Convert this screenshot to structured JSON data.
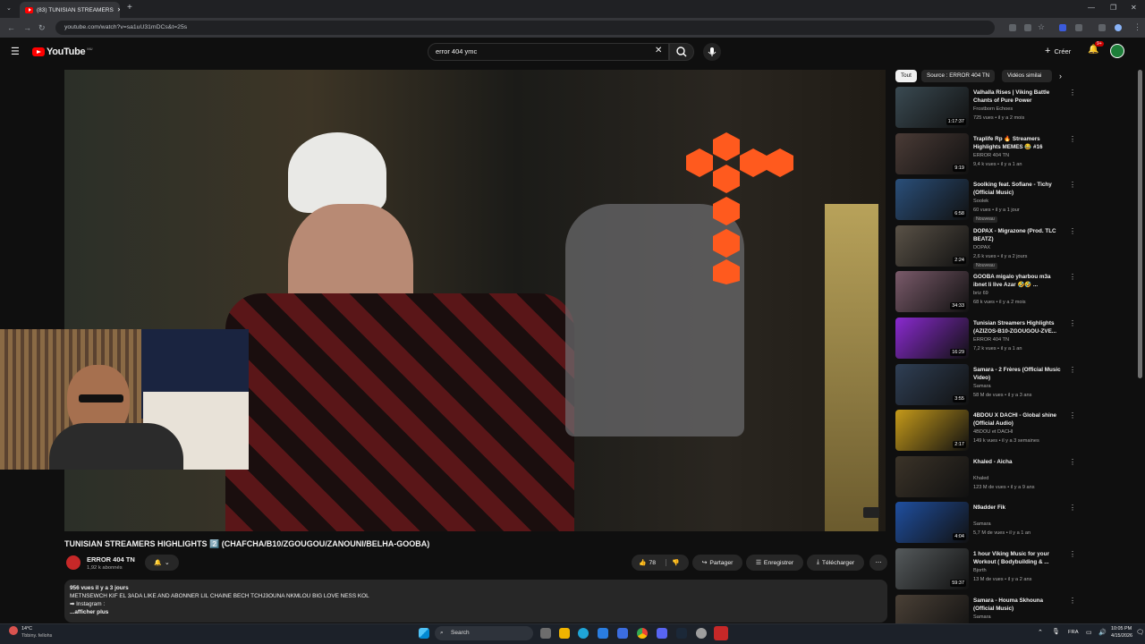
{
  "browser": {
    "tab_title": "(83) TUNISIAN STREAMERS",
    "url": "youtube.com/watch?v=sa1uU31mDCs&t=25s"
  },
  "youtube": {
    "logo": "YouTube",
    "region": "MU",
    "search_value": "error 404 ymc",
    "create_label": "Créer",
    "notif_count": "9+"
  },
  "video": {
    "title": "TUNISIAN STREAMERS HIGHLIGHTS 2️⃣ (CHAFCHA/B10/ZGOUGOU/ZANOUNI/BELHA-GOOBA)",
    "channel": "ERROR 404 TN",
    "subscribers": "1,92 k abonnés",
    "likes": "78",
    "share": "Partager",
    "save": "Enregistrer",
    "download": "Télécharger",
    "desc_meta": "956 vues  il y a 3 jours",
    "desc_line1": "METNSEWCH KIF EL 3ADA LIKE AND ABONNER LIL CHAINE BECH TCHJ3OUNA NKMLOU BIG LOVE NESS KOL",
    "desc_line2": "➡ Instagram :",
    "desc_more": "...afficher plus"
  },
  "chips": [
    "Tout",
    "Source : ERROR 404 TN",
    "Vidéos similai"
  ],
  "recommendations": [
    {
      "title": "Valhalla Rises | Viking Battle Chants of Pure Power",
      "channel": "Frostborn Echoes",
      "meta": "725 vues • il y a 2 mois",
      "duration": "1:17:37",
      "badge": "",
      "color": "#3a4a52"
    },
    {
      "title": "Traplife Rp 🔥 Streamers Highlights MEMES 😂 #16",
      "channel": "ERROR 404 TN",
      "meta": "9,4 k vues • il y a 1 an",
      "duration": "9:19",
      "badge": "",
      "color": "#4a3b36"
    },
    {
      "title": "Soolking feat. Sofiane - Tichy (Official Music)",
      "channel": "Soolek",
      "meta": "60 vues • il y a 1 jour",
      "duration": "6:58",
      "badge": "Nouveau",
      "color": "#2a4f7a"
    },
    {
      "title": "DOPAX - Migrazone (Prod. TLC BEATZ)",
      "channel": "DOPAX",
      "meta": "2,6 k vues • il y a 2 jours",
      "duration": "2:24",
      "badge": "Nouveau",
      "color": "#5a5247"
    },
    {
      "title": "GOOBA migalo yharbou m3a ibnet li live Azar 🤣🤣 ...",
      "channel": "briz 69",
      "meta": "68 k vues • il y a 2 mois",
      "duration": "34:33",
      "badge": "",
      "color": "#7a5a6a"
    },
    {
      "title": "Tunisian Streamers Highlights (AZIZOS-B10-ZGOUGOU-ZVE...",
      "channel": "ERROR 404 TN",
      "meta": "7,2 k vues • il y a 1 an",
      "duration": "16:29",
      "badge": "",
      "color": "#8a2ad0"
    },
    {
      "title": "Samara - 2 Frères (Official Music Video)",
      "channel": "Samara",
      "meta": "58 M de vues • il y a 3 ans",
      "duration": "3:55",
      "badge": "",
      "color": "#2f3f55"
    },
    {
      "title": "4BDOU X DACHI - Global shine (Official Audio)",
      "channel": "4BDOU et DACHI",
      "meta": "149 k vues • il y a 3 semaines",
      "duration": "2:17",
      "badge": "",
      "color": "#c59a1a"
    },
    {
      "title": "Khaled - Aicha",
      "channel": "Khaled",
      "meta": "123 M de vues • il y a 9 ans",
      "duration": "",
      "badge": "",
      "color": "#3b3328"
    },
    {
      "title": "N9adder Fik",
      "channel": "Samara",
      "meta": "5,7 M de vues • il y a 1 an",
      "duration": "4:04",
      "badge": "",
      "color": "#1f4fa0"
    },
    {
      "title": "1 hour Viking Music for your Workout ( Bodybuilding & ...",
      "channel": "Bjorth",
      "meta": "13 M de vues • il y a 2 ans",
      "duration": "59:37",
      "badge": "",
      "color": "#555a5c"
    },
    {
      "title": "Samara - Houma Skhouna (Official Music)",
      "channel": "Samara",
      "meta": "",
      "duration": "",
      "badge": "",
      "color": "#4a4036"
    }
  ],
  "taskbar": {
    "weather_temp": "14°C",
    "weather_desc": "Tbbiny. fellohs",
    "search": "Search",
    "lang": "FRA",
    "time": "10:05 PM",
    "date": "4/15/2026"
  }
}
